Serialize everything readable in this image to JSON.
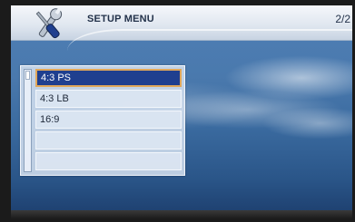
{
  "header": {
    "title": "SETUP MENU",
    "page_indicator": "2/2",
    "icon": "wrench-screwdriver-icon"
  },
  "menu": {
    "items": [
      {
        "label": "4:3 PS",
        "selected": true
      },
      {
        "label": "4:3 LB",
        "selected": false
      },
      {
        "label": "16:9",
        "selected": false
      },
      {
        "label": "",
        "selected": false
      },
      {
        "label": "",
        "selected": false
      }
    ]
  },
  "colors": {
    "selected_background": "#1f3f8f",
    "selected_border": "#e0a75a",
    "header_text": "#23324a"
  }
}
